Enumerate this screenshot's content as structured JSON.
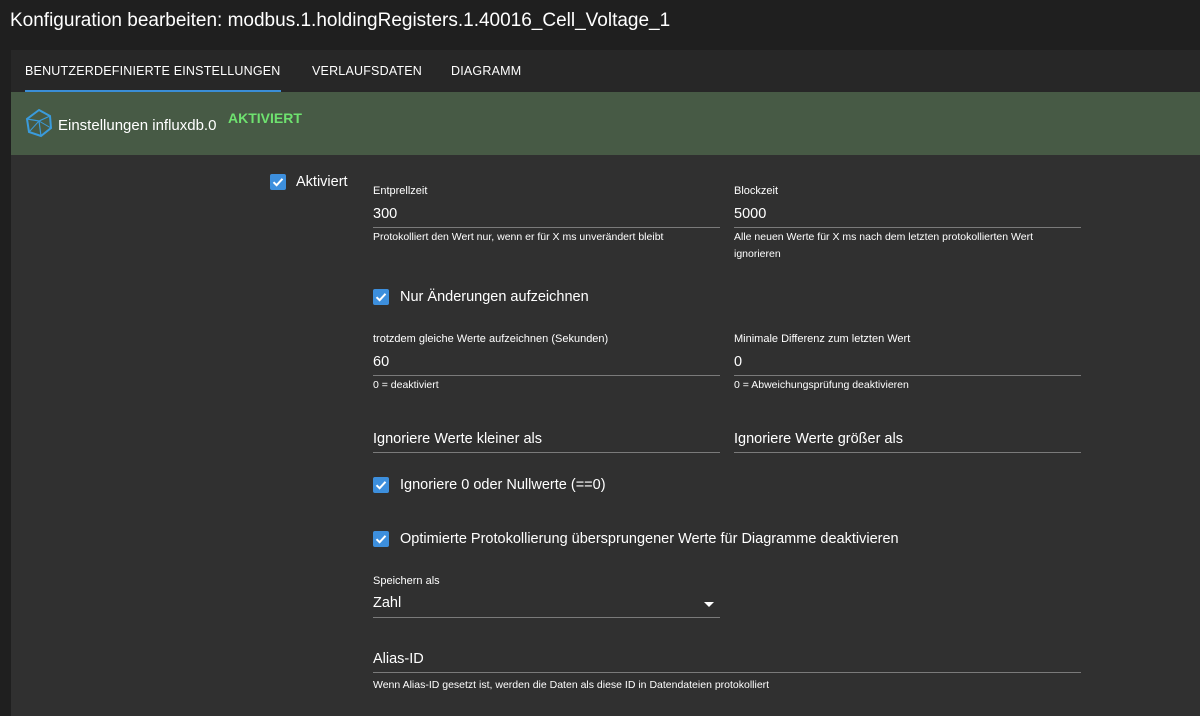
{
  "window": {
    "title": "Konfiguration bearbeiten: modbus.1.holdingRegisters.1.40016_Cell_Voltage_1"
  },
  "tabs": [
    {
      "label": "BENUTZERDEFINIERTE EINSTELLUNGEN",
      "active": true
    },
    {
      "label": "VERLAUFSDATEN",
      "active": false
    },
    {
      "label": "DIAGRAMM",
      "active": false
    }
  ],
  "banner": {
    "title": "Einstellungen influxdb.0",
    "status": "AKTIVIERT",
    "icon": "influxdb-icon",
    "color": "#475a45",
    "status_color": "#6ee26f"
  },
  "settings": {
    "enabled": {
      "label": "Aktiviert",
      "checked": true
    },
    "debounce": {
      "label": "Entprellzeit",
      "value": "300",
      "help": "Protokolliert den Wert nur, wenn er für X ms unverändert bleibt"
    },
    "block_time": {
      "label": "Blockzeit",
      "value": "5000",
      "help": "Alle neuen Werte für X ms nach dem letzten protokollierten Wert ignorieren"
    },
    "changes_only": {
      "label": "Nur Änderungen aufzeichnen",
      "checked": true
    },
    "same_values": {
      "label": "trotzdem gleiche Werte aufzeichnen (Sekunden)",
      "value": "60",
      "help": "0 = deaktiviert"
    },
    "min_diff": {
      "label": "Minimale Differenz zum letzten Wert",
      "value": "0",
      "help": "0 = Abweichungsprüfung deaktivieren"
    },
    "ignore_below": {
      "placeholder": "Ignoriere Werte kleiner als"
    },
    "ignore_above": {
      "placeholder": "Ignoriere Werte größer als"
    },
    "ignore_zero": {
      "label": "Ignoriere 0 oder Nullwerte (==0)",
      "checked": true
    },
    "disable_optimized": {
      "label": "Optimierte Protokollierung übersprungener Werte für Diagramme deaktivieren",
      "checked": true
    },
    "store_as": {
      "label": "Speichern als",
      "value": "Zahl"
    },
    "alias": {
      "placeholder": "Alias-ID",
      "help": "Wenn Alias-ID gesetzt ist, werden die Daten als diese ID in Datendateien protokolliert"
    }
  },
  "colors": {
    "accent": "#3d8fdd",
    "background": "#303030"
  }
}
